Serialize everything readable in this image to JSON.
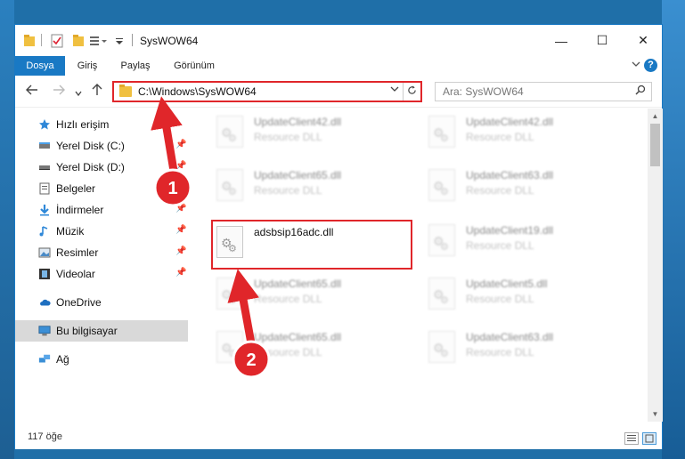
{
  "window": {
    "title": "SysWOW64",
    "controls": {
      "minimize": "—",
      "maximize": "☐",
      "close": "✕"
    }
  },
  "ribbon": {
    "tabs": [
      {
        "label": "Dosya",
        "active": true
      },
      {
        "label": "Giriş",
        "active": false
      },
      {
        "label": "Paylaş",
        "active": false
      },
      {
        "label": "Görünüm",
        "active": false
      }
    ],
    "collapse_icon": "chevron-down-icon",
    "help_label": "?"
  },
  "navigation": {
    "address": "C:\\Windows\\SysWOW64",
    "search_placeholder": "Ara: SysWOW64"
  },
  "sidebar": {
    "items": [
      {
        "label": "Hızlı erişim",
        "icon": "star-icon",
        "pinned": false
      },
      {
        "label": "Yerel Disk (C:)",
        "icon": "drive-icon",
        "pinned": true
      },
      {
        "label": "Yerel Disk (D:)",
        "icon": "drive-icon",
        "pinned": true
      },
      {
        "label": "Belgeler",
        "icon": "documents-icon",
        "pinned": true
      },
      {
        "label": "İndirmeler",
        "icon": "download-icon",
        "pinned": true
      },
      {
        "label": "Müzik",
        "icon": "music-icon",
        "pinned": true
      },
      {
        "label": "Resimler",
        "icon": "pictures-icon",
        "pinned": true
      },
      {
        "label": "Videolar",
        "icon": "video-icon",
        "pinned": true
      },
      {
        "label": "OneDrive",
        "icon": "cloud-icon",
        "pinned": false
      },
      {
        "label": "Bu bilgisayar",
        "icon": "computer-icon",
        "pinned": false,
        "selected": true
      },
      {
        "label": "Ağ",
        "icon": "network-icon",
        "pinned": false
      }
    ]
  },
  "files": [
    {
      "name": "UpdateClient42.dll",
      "type": "Resource DLL",
      "blurred": true
    },
    {
      "name": "UpdateClient42.dll",
      "type": "Resource DLL",
      "blurred": true
    },
    {
      "name": "UpdateClient65.dll",
      "type": "Resource DLL",
      "blurred": true
    },
    {
      "name": "UpdateClient63.dll",
      "type": "Resource DLL",
      "blurred": true
    },
    {
      "name": "adsbsip16adc.dll",
      "type": "",
      "blurred": false,
      "highlighted": true
    },
    {
      "name": "UpdateClient19.dll",
      "type": "Resource DLL",
      "blurred": true
    },
    {
      "name": "UpdateClient65.dll",
      "type": "Resource DLL",
      "blurred": true
    },
    {
      "name": "UpdateClient5.dll",
      "type": "Resource DLL",
      "blurred": true
    },
    {
      "name": "UpdateClient65.dll",
      "type": "Resource DLL",
      "blurred": true
    },
    {
      "name": "UpdateClient63.dll",
      "type": "Resource DLL",
      "blurred": true
    }
  ],
  "status": {
    "item_count": "117 öğe"
  },
  "annotations": [
    {
      "label": "1"
    },
    {
      "label": "2"
    }
  ],
  "colors": {
    "accent": "#1979c4",
    "highlight": "#e0262a"
  }
}
